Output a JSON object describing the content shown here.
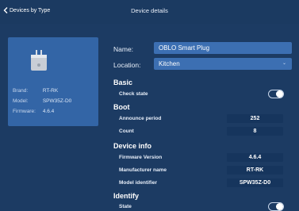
{
  "nav": {
    "back_label": "Devices by Type",
    "title": "Device details"
  },
  "device": {
    "brand_key": "Brand:",
    "brand_value": "RT-RK",
    "model_key": "Model:",
    "model_value": "SPW35Z-D0",
    "firmware_key": "Firmware:",
    "firmware_value": "4.6.4"
  },
  "form": {
    "name_label": "Name:",
    "name_value": "OBLO Smart Plug",
    "location_label": "Location:",
    "location_value": "Kitchen"
  },
  "basic": {
    "title": "Basic",
    "check_state_label": "Check state",
    "check_state_on": false
  },
  "boot": {
    "title": "Boot",
    "announce_period_label": "Announce period",
    "announce_period_value": "252",
    "count_label": "Count",
    "count_value": "8"
  },
  "device_info": {
    "title": "Device info",
    "fw_label": "Firmware Version",
    "fw_value": "4.6.4",
    "mfr_label": "Manufacturer name",
    "mfr_value": "RT-RK",
    "model_label": "Model identifier",
    "model_value": "SPW35Z-D0"
  },
  "identify": {
    "title": "Identify",
    "state_label": "State",
    "state_on": false
  }
}
